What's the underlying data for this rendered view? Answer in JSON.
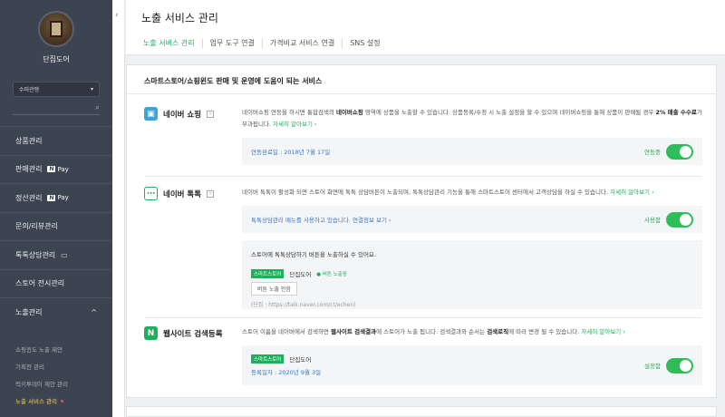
{
  "sidebar": {
    "store_name": "단집도어",
    "selector": "수퍼관맹",
    "menu": [
      {
        "label": "상품관리",
        "pay": false,
        "chat": false,
        "chevron": ""
      },
      {
        "label": "판매관리",
        "pay": true,
        "chat": false,
        "chevron": ""
      },
      {
        "label": "정산관리",
        "pay": true,
        "chat": false,
        "chevron": ""
      },
      {
        "label": "문의/리뷰관리",
        "pay": false,
        "chat": false,
        "chevron": ""
      },
      {
        "label": "톡톡상담관리",
        "pay": false,
        "chat": true,
        "chevron": ""
      },
      {
        "label": "스토어 전시관리",
        "pay": false,
        "chat": false,
        "chevron": ""
      },
      {
        "label": "노출관리",
        "pay": false,
        "chat": false,
        "chevron": "^"
      }
    ],
    "pay_label": "Pay",
    "sub_items": [
      {
        "label": "쇼핑윈도 노출 제안",
        "active": false
      },
      {
        "label": "기획전 관리",
        "active": false
      },
      {
        "label": "럭키투데이 제안 관리",
        "active": false
      },
      {
        "label": "노출 서비스 관리",
        "active": true
      }
    ]
  },
  "main": {
    "title": "노출 서비스 관리",
    "tabs": [
      {
        "label": "노출 서비스 관리",
        "active": true
      },
      {
        "label": "업무 도구 연결",
        "active": false
      },
      {
        "label": "가격비교 서비스 연결",
        "active": false
      },
      {
        "label": "SNS 설정",
        "active": false
      }
    ],
    "card_title": "스마트스토어/쇼핑윈도 판매 및 운영에 도움이 되는 서비스",
    "services": {
      "shopping": {
        "name": "네이버 쇼핑",
        "desc_a": "네이버쇼핑 연동을 하시면 통합검색의 ",
        "desc_b": "네이버쇼핑",
        "desc_c": " 영역에 상품을 노출할 수 있습니다. 상품등록/수정 시 노출 설정을 할 수 있으며 네이버쇼핑을 통해 상품이 판매될 경우 ",
        "desc_d": "2% 매출 수수료",
        "desc_e": "가 부과됩니다. ",
        "link": "자세히 알아보기 ›",
        "status_text": "연동완료일 : 2018년 7월 17일",
        "toggle_label": "연동중"
      },
      "talk": {
        "name": "네이버 톡톡",
        "desc": "네이버 톡톡이 활성화 되면 스토어 화면에 톡톡 상담버튼이 노출되며, 톡톡상담관리 기능을 통해 스마트스토어 센터에서 고객상담을 하실 수 있습니다. ",
        "link": "자세히 알아보기 ›",
        "status_text": "톡톡상담관리 메뉴를 사용하고 있습니다. ",
        "status_link": "연결정보 보기 ›",
        "toggle_label": "사용함",
        "inner_title": "스토어에 톡톡상담하기 버튼을 노출하실 수 있어요.",
        "chip": "스마트스토어",
        "store": "단집도어",
        "chip_status": "● 버튼 노출중",
        "button": "버튼 노출 안함",
        "url": "(단집 : https://talk.naver.com/ct/echen)"
      },
      "website": {
        "name": "웹사이트 검색등록",
        "desc_a": "스토어 이름을 네이버에서 검색하면 ",
        "desc_b": "웹사이트 검색결과",
        "desc_c": "에 스토어가 노출 됩니다. 검색결과와 순서는 ",
        "desc_d": "검색로직",
        "desc_e": "에 따라 변경 될 수 있습니다. ",
        "link": "자세히 알아보기 ›",
        "chip": "스마트스토어",
        "store": "단집도어",
        "date": "등록일자 : 2020년 9월 3일",
        "toggle_label": "설정함"
      }
    }
  },
  "colors": {
    "sidebar": "#3d4451",
    "accent": "#1fae5b",
    "toggle": "#2ebd58",
    "link_blue": "#3a76c4"
  },
  "icons": {
    "collapse": "chevron-left-icon",
    "search": "search-icon",
    "shopping": "shopping-bag-icon",
    "talk": "chat-icon",
    "website": "naver-n-icon"
  }
}
